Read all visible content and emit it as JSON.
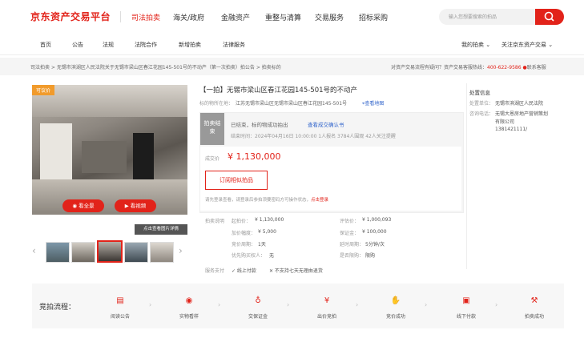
{
  "header": {
    "logo": "京东资产交易平台",
    "nav": [
      "司法拍卖",
      "海关/政府",
      "金融资产",
      "重整与清算",
      "交易服务",
      "招标采购"
    ],
    "search_placeholder": "输入您想要搜索的拍品"
  },
  "subnav": {
    "items": [
      "首页",
      "公告",
      "法规",
      "法院合作",
      "新增拍卖",
      "法律服务"
    ],
    "right_items": [
      "我的拍卖 ⌄",
      "关注京东资产交易 ⌄"
    ]
  },
  "breadcrumb": {
    "text": "司法拍卖 > 无锡市滨湖区人民法院关于无锡市梁山区春江花园145-501号的不动产（第一次拍卖）拍公告 > 拍卖标的",
    "right_text": "对资产交易流程有疑问？资产交易客服热线：",
    "phone": "400-622-9586",
    "contact": "联系客服"
  },
  "gallery": {
    "tag": "可议价",
    "btn_360": "看全景",
    "btn_video": "看视频",
    "more": "点击查看图片详情"
  },
  "item": {
    "title": "【一拍】无锡市梁山区春江花园145-501号的不动产",
    "location_label": "标的物所在地：",
    "location": "江苏无锡市梁山区无锡市梁山区春江花园145-501号",
    "location_map": "查看地图",
    "status_badge": "拍卖结束",
    "status_line1": "已结束，标的物成功拍出",
    "status_link": "查看成交确认书",
    "status_line2": "结束时间：2024年04月16日 10:00:00    1人报名    3784人围观    42人关注提醒",
    "deal_label": "成交价",
    "deal_price": "¥ 1,130,000",
    "subscribe": "订阅相似拍品",
    "notice": "请先登录查看，请登录后参拍须要密码方可操作状态，",
    "notice_link": "点击登录"
  },
  "details": {
    "section_label": "拍卖说明",
    "rows": [
      {
        "l1": "起拍价：",
        "v1": "¥ 1,130,000",
        "l2": "评估价：",
        "v2": "¥ 1,000,093"
      },
      {
        "l1": "加价幅度：",
        "v1": "¥ 5,000",
        "l2": "保证金：",
        "v2": "¥ 100,000"
      },
      {
        "l1": "竞价周期：",
        "v1": "1天",
        "l2": "延时周期：",
        "v2": "5分钟/次"
      },
      {
        "l1": "优先购买权人：",
        "v1": "无",
        "l2": "是否限购：",
        "v2": "限购"
      }
    ],
    "pay_label": "服务支付",
    "pay_1": "✓ 线上付款",
    "pay_2": "✕ 不支持七天无理由退货"
  },
  "court": {
    "title": "处置信息",
    "rows": [
      {
        "l": "处置单位：",
        "v": "无锡市滨湖区人民法院"
      },
      {
        "l": "咨询电话：",
        "v": "无锡大恩房地产营销策划"
      },
      {
        "l": "",
        "v": "有限公司"
      },
      {
        "l": "",
        "v": "1381421111/"
      }
    ]
  },
  "process": {
    "title": "竞拍流程：",
    "steps": [
      "阅读公告",
      "实物看样",
      "交保证金",
      "出价竞拍",
      "竞价成功",
      "线下付款",
      "拍卖成功"
    ]
  },
  "colors": {
    "brand": "#e2231a",
    "link": "#3366cc",
    "accent": "#f19b2c"
  }
}
